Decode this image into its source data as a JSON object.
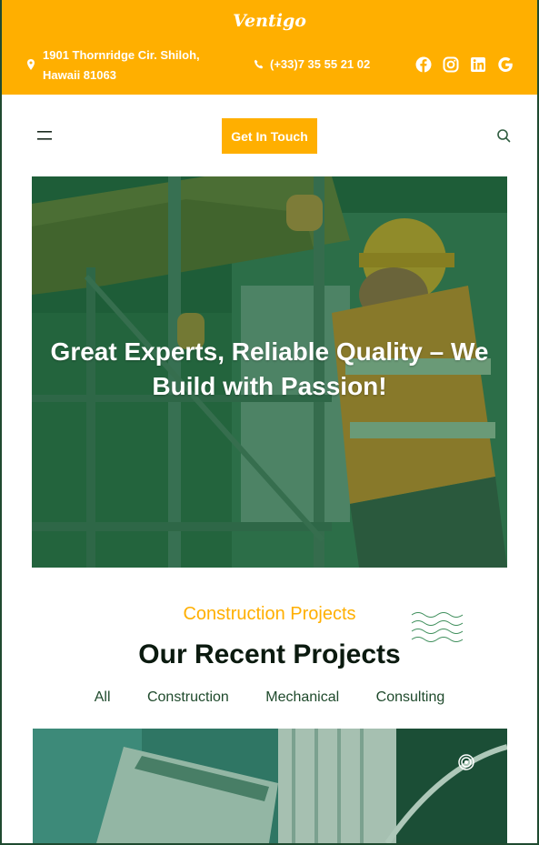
{
  "brand": {
    "logo": "Ventigo",
    "accent": "#ffaf00",
    "dark_green": "#1f4a30"
  },
  "topbar": {
    "address": "1901 Thornridge Cir. Shiloh, Hawaii 81063",
    "phone": "(+33)7 35 55 21 02",
    "social": [
      "facebook-icon",
      "instagram-icon",
      "linkedin-icon",
      "google-icon"
    ]
  },
  "header": {
    "cta_label": "Get In Touch"
  },
  "hero": {
    "title": "Great Experts, Reliable Quality – We Build with Passion!"
  },
  "projects": {
    "kicker": "Construction Projects",
    "title": "Our Recent Projects",
    "filters": [
      "All",
      "Construction",
      "Mechanical",
      "Consulting"
    ]
  }
}
